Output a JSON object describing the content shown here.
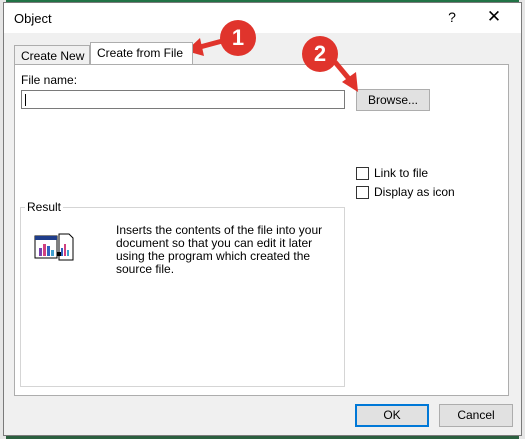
{
  "dialog": {
    "title": "Object",
    "help_glyph": "?",
    "close_glyph": "✕"
  },
  "tabs": [
    {
      "label": "Create New",
      "active": false
    },
    {
      "label": "Create from File",
      "active": true
    }
  ],
  "form": {
    "filename_label": "File name:",
    "filename_value": "",
    "browse_label": "Browse...",
    "link_label": "Link to file",
    "display_icon_label": "Display as icon"
  },
  "result": {
    "legend": "Result",
    "text": "Inserts the contents of the file into your document so that you can edit it later using the program which created the source file."
  },
  "buttons": {
    "ok": "OK",
    "cancel": "Cancel"
  },
  "annotations": {
    "badge1": "1",
    "badge2": "2",
    "color": "#e0342c"
  },
  "icons": {
    "result_icon": "document-chart-icon"
  }
}
